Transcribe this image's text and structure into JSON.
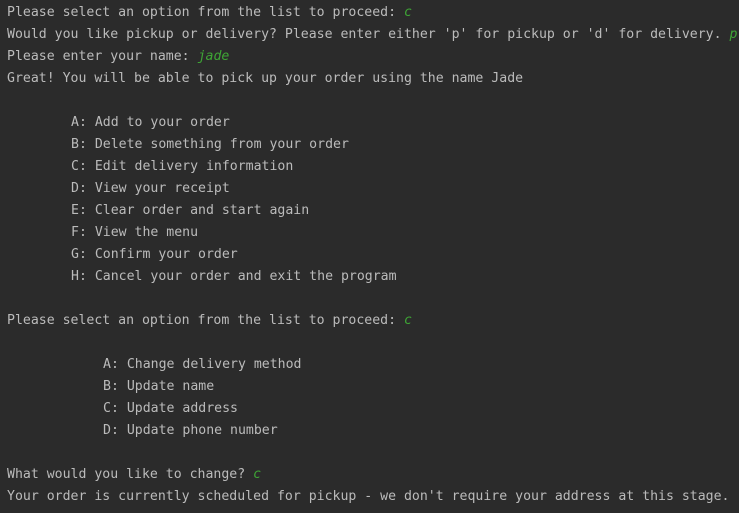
{
  "colors": {
    "background": "#2b2b2b",
    "output_text": "#bbbbbb",
    "user_input": "#3ea535"
  },
  "console": {
    "line1": {
      "prompt": "Please select an option from the list to proceed: ",
      "input": "c"
    },
    "line2": {
      "prompt": "Would you like pickup or delivery? Please enter either 'p' for pickup or 'd' for delivery. ",
      "input": "p"
    },
    "line3": {
      "prompt": "Please enter your name: ",
      "input": "jade"
    },
    "line4": "Great! You will be able to pick up your order using the name Jade",
    "main_menu": [
      "A: Add to your order",
      "B: Delete something from your order",
      "C: Edit delivery information",
      "D: View your receipt",
      "E: Clear order and start again",
      "F: View the menu",
      "G: Confirm your order",
      "H: Cancel your order and exit the program"
    ],
    "line5": {
      "prompt": "Please select an option from the list to proceed: ",
      "input": "c"
    },
    "edit_menu": [
      "A: Change delivery method",
      "B: Update name",
      "C: Update address",
      "D: Update phone number"
    ],
    "line6": {
      "prompt": "What would you like to change? ",
      "input": "c"
    },
    "line7": "Your order is currently scheduled for pickup - we don't require your address at this stage."
  }
}
